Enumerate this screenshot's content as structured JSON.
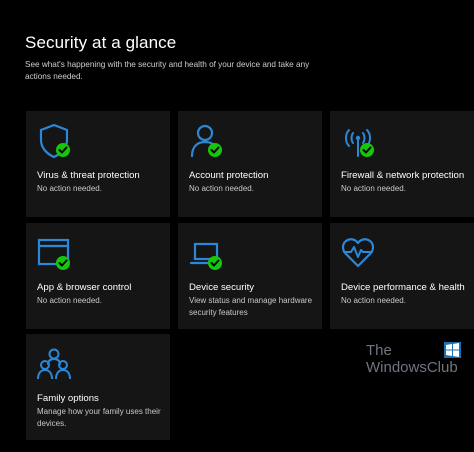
{
  "header": {
    "title": "Security at a glance",
    "subtitle": "See what's happening with the security and health of your device and take any actions needed."
  },
  "colors": {
    "background": "#000000",
    "tile": "#151515",
    "accent_icon": "#2b88d8",
    "ok_badge": "#16c60c"
  },
  "tiles": [
    {
      "title": "Virus & threat protection",
      "status": "No action needed.",
      "icon": "shield-icon",
      "badge": "check"
    },
    {
      "title": "Account protection",
      "status": "No action needed.",
      "icon": "person-icon",
      "badge": "check"
    },
    {
      "title": "Firewall & network protection",
      "status": "No action needed.",
      "icon": "antenna-icon",
      "badge": "check"
    },
    {
      "title": "App & browser control",
      "status": "No action needed.",
      "icon": "browser-window-icon",
      "badge": "check"
    },
    {
      "title": "Device security",
      "status": "View status and manage hardware security features",
      "icon": "laptop-icon",
      "badge": "none"
    },
    {
      "title": "Device performance & health",
      "status": "No action needed.",
      "icon": "heart-pulse-icon",
      "badge": "check"
    },
    {
      "title": "Family options",
      "status": "Manage how your family uses their devices.",
      "icon": "family-icon",
      "badge": "none"
    }
  ],
  "watermark": {
    "line1": "The",
    "line2": "WindowsClub"
  }
}
